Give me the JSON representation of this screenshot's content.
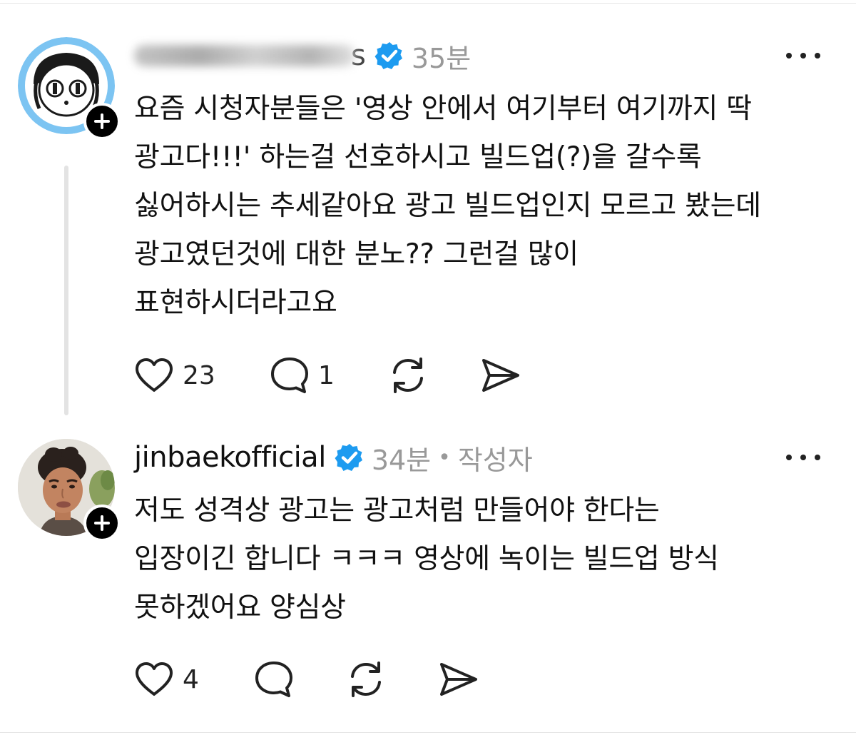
{
  "posts": [
    {
      "username_tail": "s",
      "time": "35분",
      "body_lines": [
        "요즘 시청자분들은 '영상 안에서 여기부터 여기까지 딱",
        "광고다!!!' 하는걸 선호하시고 빌드업(?)을 갈수록",
        "싫어하시는 추세같아요 광고 빌드업인지 모르고 봤는데",
        "광고였던것에 대한 분노?? 그런걸 많이",
        "표현하시더라고요"
      ],
      "likes": "23",
      "replies": "1"
    },
    {
      "username": "jinbaekofficial",
      "time": "34분",
      "separator": "•",
      "author_tag": "작성자",
      "body_lines": [
        "저도 성격상 광고는 광고처럼 만들어야 한다는",
        "입장이긴 합니다 ㅋㅋㅋ 영상에 녹이는 빌드업 방식",
        "못하겠어요 양심상"
      ],
      "likes": "4"
    }
  ],
  "colors": {
    "verified_blue": "#1d9bf0",
    "meta_gray": "#999999",
    "thread_line": "#e3e3e3",
    "avatar_ring_blue": "#7cc4f2"
  },
  "icons": [
    "verified-icon",
    "more-icon",
    "heart-icon",
    "comment-icon",
    "repost-icon",
    "share-icon",
    "plus-icon"
  ]
}
